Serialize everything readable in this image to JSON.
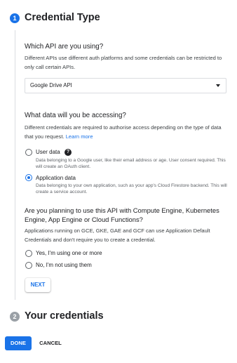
{
  "step1": {
    "number": "1",
    "title": "Credential Type",
    "q_api": "Which API are you using?",
    "q_api_desc": "Different APIs use different auth platforms and some credentials can be restricted to only call certain APIs.",
    "api_select": {
      "value": "Google Drive API"
    },
    "q_data": "What data will you be accessing?",
    "q_data_desc": "Different credentials are required to authorise access depending on the type of data that you request.",
    "learn_more": "Learn more",
    "data_options": [
      {
        "label": "User data",
        "desc": "Data belonging to a Google user, like their email address or age. User consent required. This will create an OAuth client.",
        "checked": false
      },
      {
        "label": "Application data",
        "desc": "Data belonging to your own application, such as your app's Cloud Firestore backend. This will create a service account.",
        "checked": true
      }
    ],
    "help_icon": "?",
    "q_engine": "Are you planning to use this API with Compute Engine, Kubernetes Engine, App Engine or Cloud Functions?",
    "q_engine_desc": "Applications running on GCE, GKE, GAE and GCF can use Application Default Credentials and don't require you to create a credential.",
    "engine_options": [
      {
        "label": "Yes, I'm using one or more",
        "checked": false
      },
      {
        "label": "No, I'm not using them",
        "checked": false
      }
    ],
    "next_label": "NEXT"
  },
  "step2": {
    "number": "2",
    "title": "Your credentials"
  },
  "footer": {
    "done_label": "DONE",
    "cancel_label": "CANCEL"
  },
  "colors": {
    "accent": "#1a73e8",
    "inactive_step": "#9aa0a6",
    "text": "#202124"
  }
}
